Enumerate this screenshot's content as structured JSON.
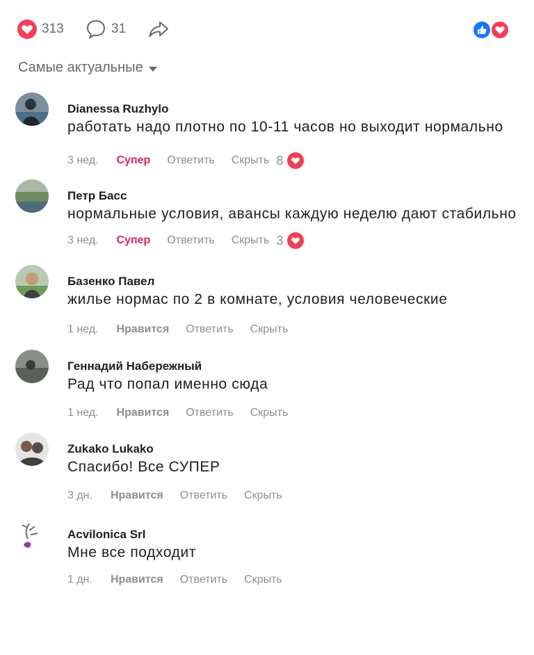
{
  "header": {
    "likes_count": "313",
    "comments_count": "31",
    "reactions": [
      "like-icon",
      "love-icon"
    ]
  },
  "sort": {
    "label": "Самые актуальные"
  },
  "comments": [
    {
      "author": "Dianessa Ruzhylo",
      "text": "работать надо плотно по 10-11 часов но выходит нормально",
      "time": "3 нед.",
      "reaction": "Супер",
      "reply": "Ответить",
      "hide": "Скрыть",
      "count": "8"
    },
    {
      "author": "Петр Басс",
      "text": "нормальные условия, авансы каждую неделю дают стабильно",
      "time": "3 нед.",
      "reaction": "Супер",
      "reply": "Ответить",
      "hide": "Скрыть",
      "count": "3"
    },
    {
      "author": "Базенко Павел",
      "text": "жилье нормас по 2 в комнате, условия человеческие",
      "time": "1 нед.",
      "reaction": "Нравится",
      "reply": "Ответить",
      "hide": "Скрыть"
    },
    {
      "author": "Геннадий Набережный",
      "text": "Рад что попал именно сюда",
      "time": "1 нед.",
      "reaction": "Нравится",
      "reply": "Ответить",
      "hide": "Скрыть"
    },
    {
      "author": "Zukako Lukako",
      "text": "Спасибо! Все СУПЕР",
      "time": "3 дн.",
      "reaction": "Нравится",
      "reply": "Ответить",
      "hide": "Скрыть"
    },
    {
      "author": "Acvilonica Srl",
      "text": "Мне все подходит",
      "time": "1 дн.",
      "reaction": "Нравится",
      "reply": "Ответить",
      "hide": "Скрыть"
    }
  ],
  "colors": {
    "super": "#e0245e",
    "like_blue": "#1877f2",
    "love_red": "#f33e58",
    "muted": "#8a8d91"
  }
}
